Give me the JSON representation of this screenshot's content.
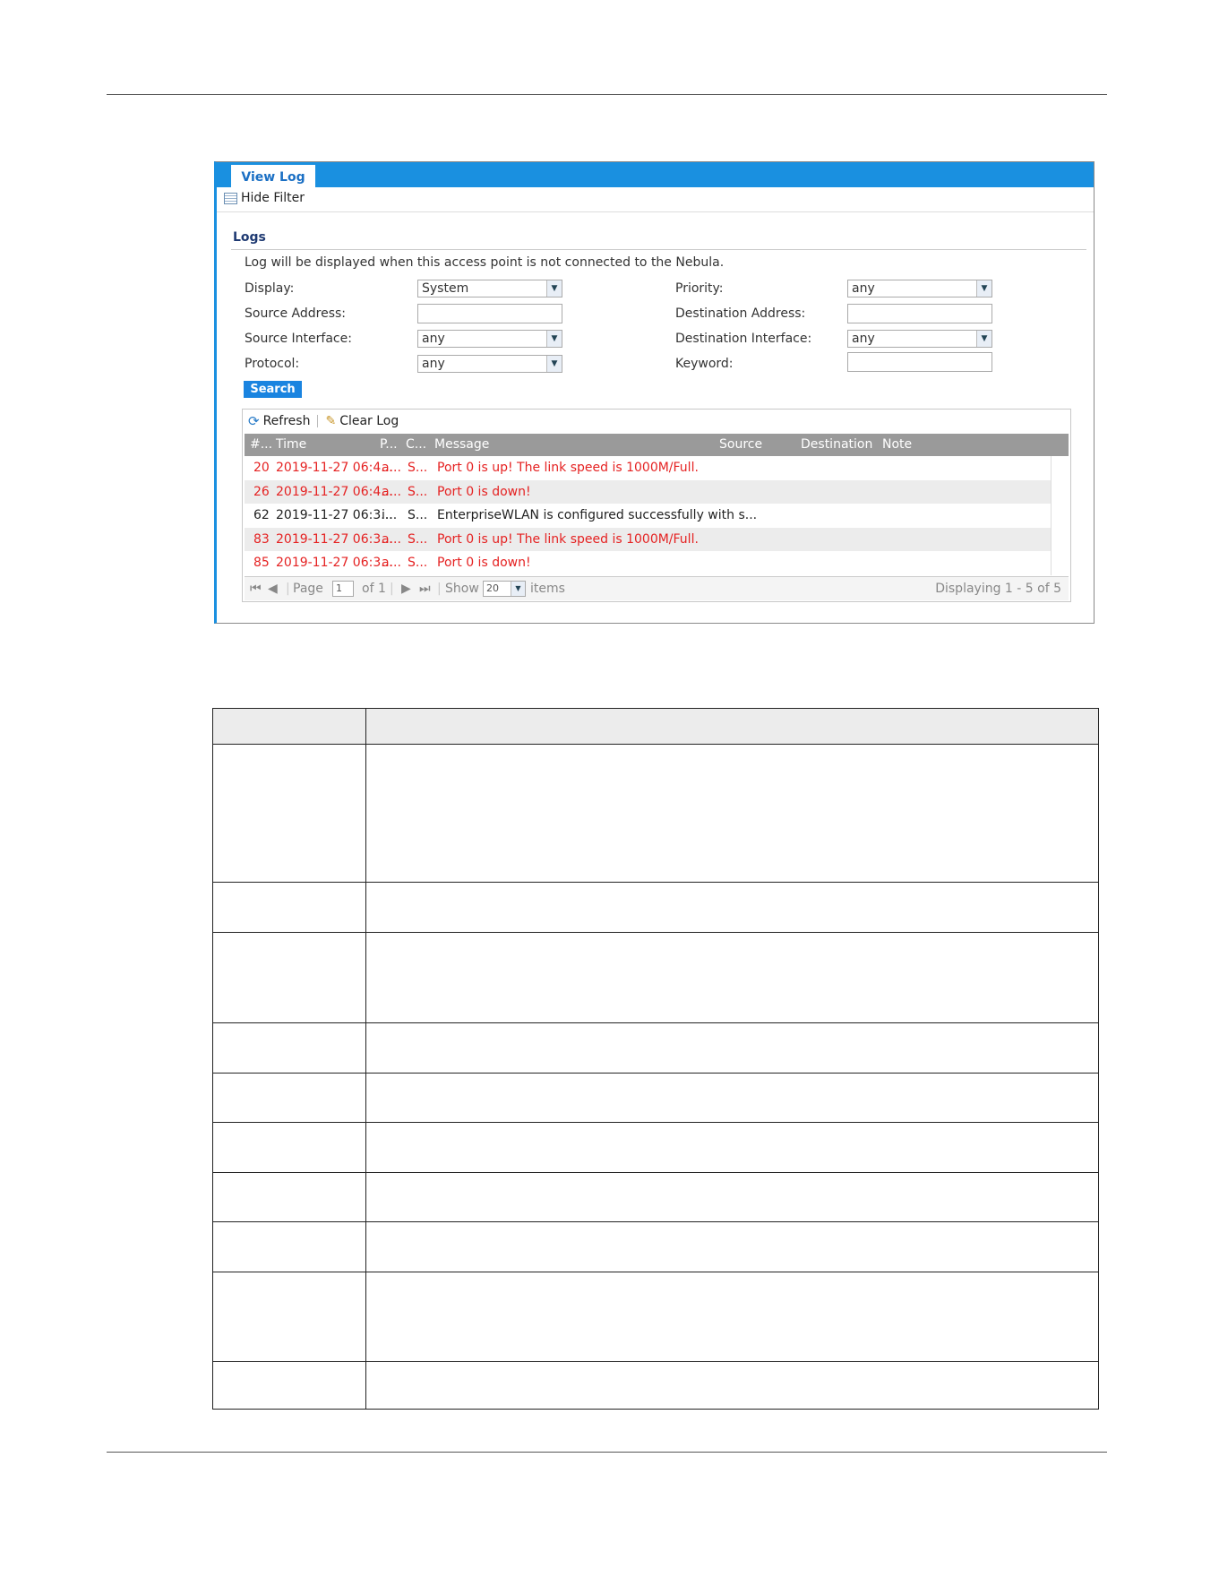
{
  "tab": {
    "label": "View Log"
  },
  "filter_toggle": {
    "label": "Hide Filter"
  },
  "section": {
    "title": "Logs"
  },
  "notice": "Log will be displayed when this access point is not connected to the Nebula.",
  "filters": {
    "display": {
      "label": "Display:",
      "value": "System"
    },
    "priority": {
      "label": "Priority:",
      "value": "any"
    },
    "source_address": {
      "label": "Source Address:",
      "value": ""
    },
    "destination_address": {
      "label": "Destination Address:",
      "value": ""
    },
    "source_interface": {
      "label": "Source Interface:",
      "value": "any"
    },
    "destination_interface": {
      "label": "Destination Interface:",
      "value": "any"
    },
    "protocol": {
      "label": "Protocol:",
      "value": "any"
    },
    "keyword": {
      "label": "Keyword:",
      "value": ""
    }
  },
  "search_label": "Search",
  "toolbar": {
    "refresh": "Refresh",
    "clear": "Clear Log"
  },
  "columns": {
    "num": "#...",
    "time": "Time",
    "priority": "P...",
    "category": "C...",
    "message": "Message",
    "source": "Source",
    "destination": "Destination",
    "note": "Note"
  },
  "rows": [
    {
      "num": "20",
      "time": "2019-11-27 06:4...",
      "priority": "a...",
      "category": "S...",
      "message": "Port 0 is up! The link speed is 1000M/Full.",
      "color": "#e52222"
    },
    {
      "num": "26",
      "time": "2019-11-27 06:4...",
      "priority": "a...",
      "category": "S...",
      "message": "Port 0 is down!",
      "color": "#e52222"
    },
    {
      "num": "62",
      "time": "2019-11-27 06:3...",
      "priority": "i...",
      "category": "S...",
      "message": "EnterpriseWLAN is configured successfully with s...",
      "color": "#222222"
    },
    {
      "num": "83",
      "time": "2019-11-27 06:3...",
      "priority": "a...",
      "category": "S...",
      "message": "Port 0 is up! The link speed is 1000M/Full.",
      "color": "#e52222"
    },
    {
      "num": "85",
      "time": "2019-11-27 06:3...",
      "priority": "a...",
      "category": "S...",
      "message": "Port 0 is down!",
      "color": "#e52222"
    }
  ],
  "pager": {
    "page_label": "Page",
    "page_value": "1",
    "of_label": "of 1",
    "show_label": "Show",
    "show_value": "20",
    "items_label": "items",
    "displaying": "Displaying 1 - 5 of 5"
  },
  "colors": {
    "accent": "#1a90e0",
    "alert": "#e52222",
    "header": "#9a9a9a"
  }
}
